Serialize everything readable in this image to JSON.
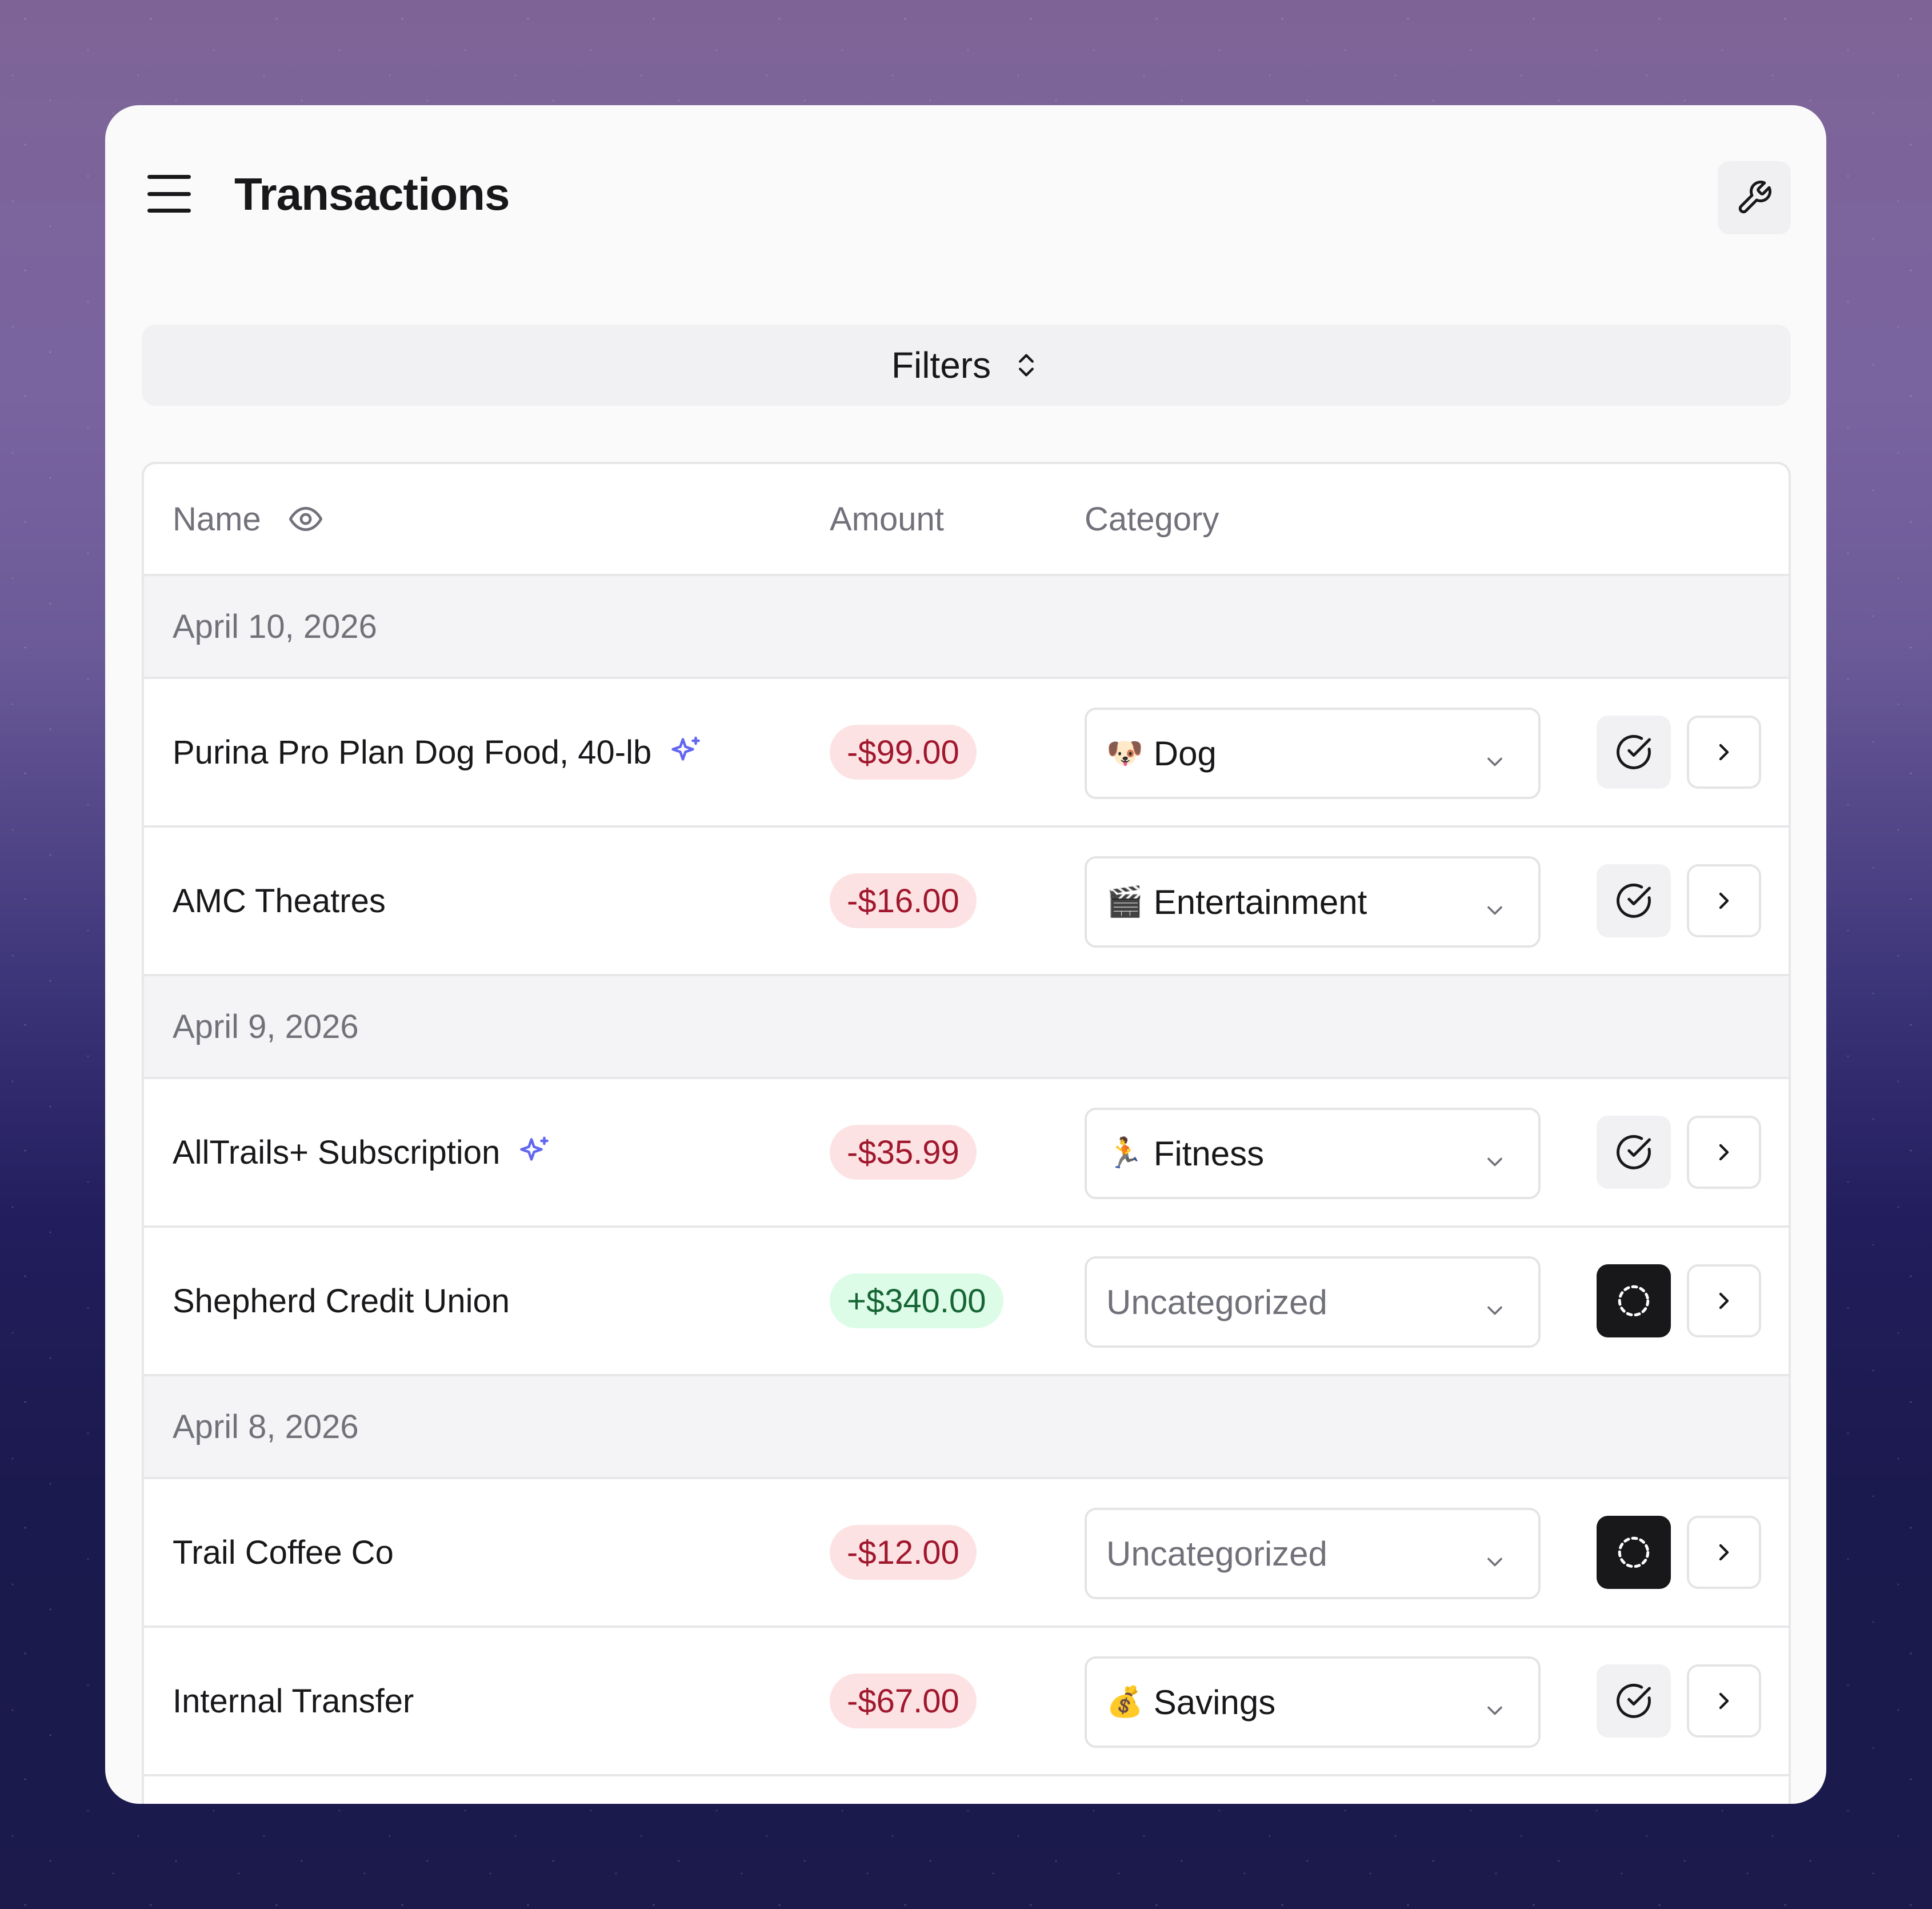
{
  "header": {
    "title": "Transactions",
    "menu_icon": "hamburger-icon",
    "settings_icon": "wrench-icon"
  },
  "filters": {
    "label": "Filters",
    "icon": "chevrons-up-down-icon"
  },
  "table": {
    "columns": {
      "name": "Name",
      "amount": "Amount",
      "category": "Category"
    },
    "groups": [
      {
        "date": "April 10, 2026",
        "transactions": [
          {
            "name": "Purina Pro Plan Dog Food, 40-lb",
            "ai": true,
            "amount": "-$99.00",
            "sign": "neg",
            "category": "Dog",
            "emoji": "🐶",
            "reviewed": true
          },
          {
            "name": "AMC Theatres",
            "ai": false,
            "amount": "-$16.00",
            "sign": "neg",
            "category": "Entertainment",
            "emoji": "🎬",
            "reviewed": true
          }
        ]
      },
      {
        "date": "April 9, 2026",
        "transactions": [
          {
            "name": "AllTrails+ Subscription",
            "ai": true,
            "amount": "-$35.99",
            "sign": "neg",
            "category": "Fitness",
            "emoji": "🏃",
            "reviewed": true
          },
          {
            "name": "Shepherd Credit Union",
            "ai": false,
            "amount": "+$340.00",
            "sign": "pos",
            "category": "Uncategorized",
            "emoji": "",
            "reviewed": false
          }
        ]
      },
      {
        "date": "April 8, 2026",
        "transactions": [
          {
            "name": "Trail Coffee Co",
            "ai": false,
            "amount": "-$12.00",
            "sign": "neg",
            "category": "Uncategorized",
            "emoji": "",
            "reviewed": false
          },
          {
            "name": "Internal Transfer",
            "ai": false,
            "amount": "-$67.00",
            "sign": "neg",
            "category": "Savings",
            "emoji": "💰",
            "reviewed": true
          }
        ]
      }
    ]
  },
  "colors": {
    "negative_bg": "#fde2e4",
    "negative_text": "#a0182d",
    "positive_bg": "#dcfce7",
    "positive_text": "#166534",
    "ai_sparkle": "#6366f1"
  }
}
